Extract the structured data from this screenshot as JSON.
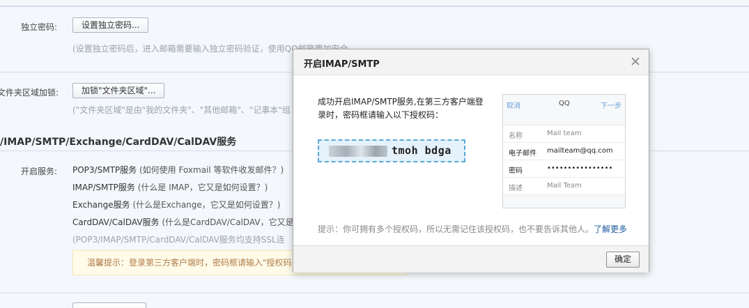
{
  "background": {
    "independent_password": {
      "label": "独立密码:",
      "button": "设置独立密码...",
      "hint": "(设置独立密码后，进入邮箱需要输入独立密码验证，使用QQ邮箱更加安全。"
    },
    "folder_lock": {
      "label": "文件夹区域加锁:",
      "button": "加锁\"文件夹区域\"...",
      "hint": "(\"文件夹区域\"是由\"我的文件夹\"、\"其他邮箱\"、\"记事本\"组"
    },
    "section_title": "/IMAP/SMTP/Exchange/CardDAV/CalDAV服务",
    "services_label": "开启服务:",
    "services": [
      {
        "name": "POP3/SMTP服务",
        "note": "(如何使用 Foxmail 等软件收发邮件？)"
      },
      {
        "name": "IMAP/SMTP服务",
        "note": "(什么是 IMAP，它又是如何设置？)"
      },
      {
        "name": "Exchange服务",
        "note": "(什么是Exchange，它又是如何设置？)"
      },
      {
        "name": "CardDAV/CalDAV服务",
        "note": "(什么是CardDAV/CalDAV，它又是"
      }
    ],
    "ssl_hint": "(POP3/IMAP/SMTP/CardDAV/CalDAV服务均支持SSL连",
    "warning": "温馨提示：登录第三方客户端时，密码框请输入\"授权码"
  },
  "dialog": {
    "title": "开启IMAP/SMTP",
    "message": "成功开启IMAP/SMTP服务,在第三方客户端登录时，密码框请输入以下授权码：",
    "code_visible": "tmoh bdga",
    "phone": {
      "cancel": "取消",
      "account": "QQ",
      "next": "下一步",
      "rows": [
        {
          "key": "名称",
          "value": "Mail team"
        },
        {
          "key": "电子邮件",
          "value": "mailteam@qq.com"
        },
        {
          "key": "密码",
          "value": "••••••••••••••••"
        },
        {
          "key": "描述",
          "value": "Mail Team"
        }
      ]
    },
    "tip": "提示：你可拥有多个授权码，所以无需记住该授权码，也不要告诉其他人。",
    "learn_more": "了解更多",
    "ok": "确定"
  }
}
